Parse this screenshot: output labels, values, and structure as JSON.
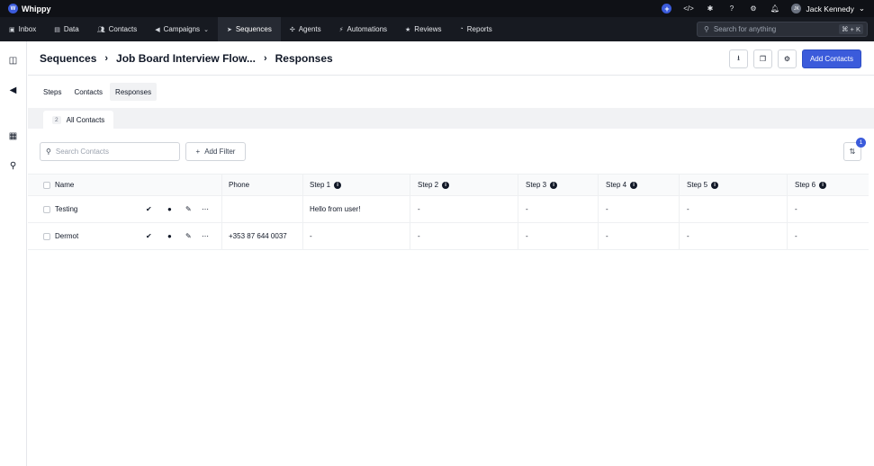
{
  "app": {
    "name": "Whippy"
  },
  "topbar": {
    "user_name": "Jack Kennedy",
    "user_initials": "JK"
  },
  "nav": {
    "items": [
      {
        "label": "Inbox",
        "icon": "inbox-icon",
        "active": false
      },
      {
        "label": "Data",
        "icon": "data-icon",
        "active": false
      },
      {
        "label": "Contacts",
        "icon": "contacts-icon",
        "active": false
      },
      {
        "label": "Campaigns",
        "icon": "megaphone-icon",
        "active": false
      },
      {
        "label": "Sequences",
        "icon": "sequence-icon",
        "active": true
      },
      {
        "label": "Agents",
        "icon": "agents-icon",
        "active": false
      },
      {
        "label": "Automations",
        "icon": "bolt-icon",
        "active": false
      },
      {
        "label": "Reviews",
        "icon": "star-icon",
        "active": false
      },
      {
        "label": "Reports",
        "icon": "pie-chart-icon",
        "active": false
      }
    ],
    "search_placeholder": "Search for anything",
    "search_shortcut": "⌘ + K"
  },
  "header": {
    "breadcrumbs": [
      "Sequences",
      "Job Board Interview Flow...",
      "Responses"
    ],
    "add_contacts_label": "Add Contacts"
  },
  "tabs": [
    "Steps",
    "Contacts",
    "Responses"
  ],
  "active_tab": "Responses",
  "segment": {
    "count": "2",
    "label": "All Contacts"
  },
  "filters": {
    "search_placeholder": "Search Contacts",
    "add_filter_label": "Add Filter",
    "sort_badge": "1"
  },
  "table": {
    "columns": [
      "Name",
      "Phone",
      "Step 1",
      "Step 2",
      "Step 3",
      "Step 4",
      "Step 5",
      "Step 6"
    ],
    "rows": [
      {
        "name": "Testing",
        "phone": "",
        "steps": [
          "Hello from user!",
          "-",
          "-",
          "-",
          "-",
          "-"
        ]
      },
      {
        "name": "Dermot",
        "phone": "+353 87 644 0037",
        "steps": [
          "-",
          "-",
          "-",
          "-",
          "-",
          "-"
        ]
      }
    ]
  },
  "colors": {
    "accent": "#3b5bdb",
    "topbar": "#0f1116",
    "navbar": "#171a21"
  }
}
